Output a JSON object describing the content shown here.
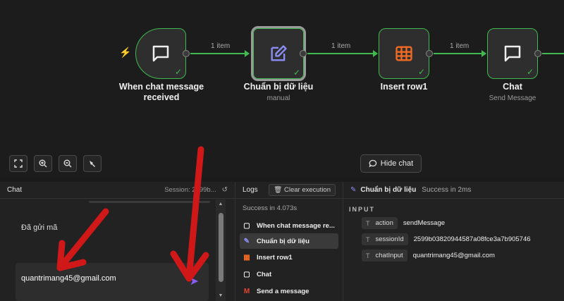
{
  "workflow": {
    "nodes": [
      {
        "title": "When chat message received",
        "subtitle": "",
        "icon": "chat-icon"
      },
      {
        "title": "Chuẩn bị dữ liệu",
        "subtitle": "manual",
        "icon": "edit-icon"
      },
      {
        "title": "Insert row1",
        "subtitle": "",
        "icon": "table-icon"
      },
      {
        "title": "Chat",
        "subtitle": "Send Message",
        "icon": "chat-icon"
      }
    ],
    "connection_labels": [
      "1 item",
      "1 item",
      "1 item"
    ]
  },
  "toolbar": {
    "hide_chat_label": "Hide chat"
  },
  "chat": {
    "title": "Chat",
    "session": "Session: 2599b...",
    "message": "Đã gửi mã",
    "input_value": "quantrimang45@gmail.com"
  },
  "logs": {
    "title": "Logs",
    "clear_label": "Clear execution",
    "success_text": "Success in 4.073s",
    "items": [
      {
        "label": "When chat message re...",
        "icon": "chat-icon"
      },
      {
        "label": "Chuẩn bị dữ liệu",
        "icon": "edit-icon"
      },
      {
        "label": "Insert row1",
        "icon": "table-icon"
      },
      {
        "label": "Chat",
        "icon": "chat-icon"
      },
      {
        "label": "Send a message",
        "icon": "gmail-icon"
      }
    ]
  },
  "detail": {
    "node_name": "Chuẩn bị dữ liệu",
    "status": "Success in 2ms",
    "section": "INPUT",
    "fields": [
      {
        "key": "action",
        "value": "sendMessage"
      },
      {
        "key": "sessionId",
        "value": "2599b03820944587a08fce3a7b905746"
      },
      {
        "key": "chatInput",
        "value": "quantrimang45@gmail.com"
      }
    ]
  },
  "colors": {
    "success": "#3fb950",
    "trigger_bolt": "#f26b22",
    "edit_icon": "#8b8ff5",
    "table_icon": "#f26b22",
    "send_icon": "#8a5cf6",
    "annotation_red": "#d01818"
  }
}
